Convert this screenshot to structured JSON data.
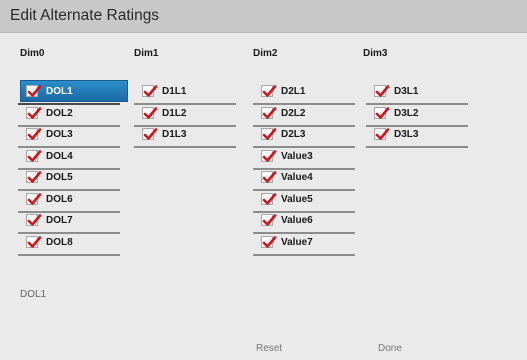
{
  "window": {
    "title": "Edit Alternate Ratings"
  },
  "dimensions": [
    {
      "header": "Dim0",
      "items": [
        "DOL1",
        "DOL2",
        "DOL3",
        "DOL4",
        "DOL5",
        "DOL6",
        "DOL7",
        "DOL8"
      ]
    },
    {
      "header": "Dim1",
      "items": [
        "D1L1",
        "D1L2",
        "D1L3"
      ]
    },
    {
      "header": "Dim2",
      "items": [
        "D2L1",
        "D2L2",
        "D2L3",
        "Value3",
        "Value4",
        "Value5",
        "Value6",
        "Value7"
      ]
    },
    {
      "header": "Dim3",
      "items": [
        "D3L1",
        "D3L2",
        "D3L3"
      ]
    }
  ],
  "selected_item": "DOL1",
  "footer": {
    "current_value": "DOL1",
    "reset_label": "Reset",
    "done_label": "Done"
  },
  "colors": {
    "check": "#d0141a",
    "selection": "#1f74b3"
  }
}
